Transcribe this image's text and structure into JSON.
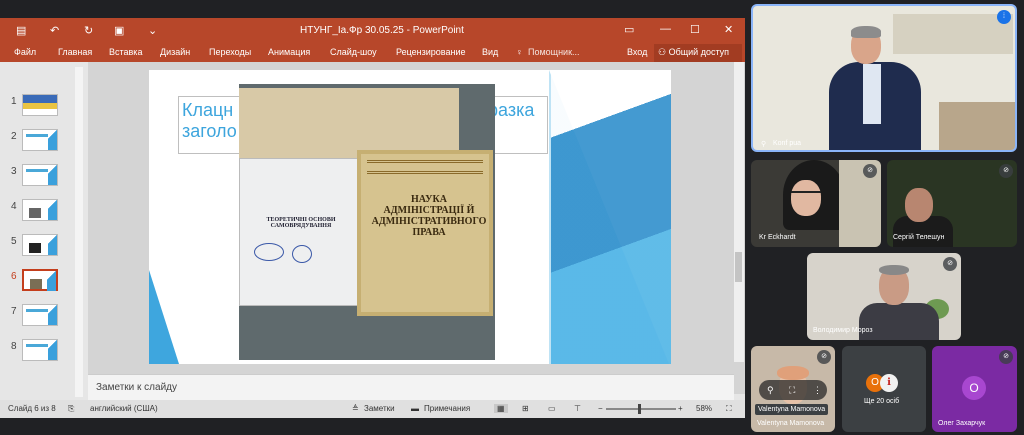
{
  "powerpoint": {
    "window_title": "НТУНГ_Іа.Фр 30.05.25 - PowerPoint",
    "tabs": [
      "Файл",
      "Главная",
      "Вставка",
      "Дизайн",
      "Переходы",
      "Анимация",
      "Слайд-шоу",
      "Рецензирование",
      "Вид"
    ],
    "tell_me": "Помощник...",
    "sign_in": "Вход",
    "share": "Общий доступ",
    "thumbnails": [
      "1",
      "2",
      "3",
      "4",
      "5",
      "6",
      "7",
      "8"
    ],
    "selected_slide": "6",
    "slide": {
      "title_line1": "Клацн",
      "title_line1_right": "разка",
      "title_line2": "заголо",
      "book1_title": "ТЕОРЕТИЧНІ ОСНОВИ САМОВРЯДУВАННЯ",
      "book2_title": "НАУКА АДМІНІСТРАЦІЇ Й АДМІНІСТРАТИВНОГО ПРАВА"
    },
    "notes_placeholder": "Заметки к слайду",
    "status": {
      "slide_count": "Слайд 6 из 8",
      "language": "английский (США)",
      "notes_btn": "Заметки",
      "comments_btn": "Примечания",
      "zoom": "58%"
    },
    "accent": "#b7472a"
  },
  "meeting": {
    "main_speaker_label": "Konf pua",
    "participants": [
      "Kr",
      "Eckhardt",
      "Сергій Телешун",
      "Володимир Мороз",
      "Valentyna Mamonova",
      "Valentyna Mamonova",
      "Олег Захарчук"
    ],
    "more_count": "Ще 20 осіб",
    "ole_avatar": "О"
  }
}
